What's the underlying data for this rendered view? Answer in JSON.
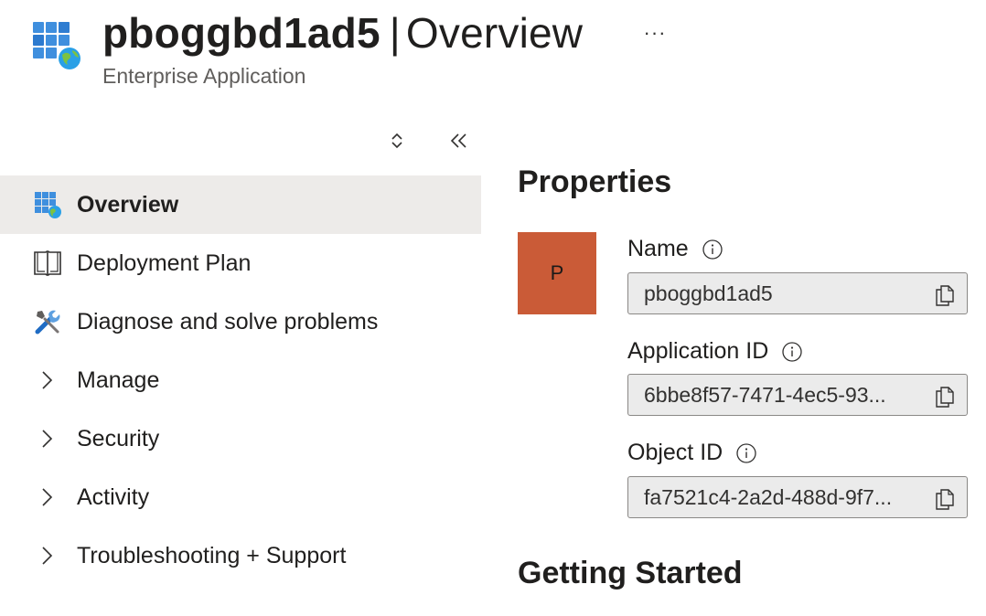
{
  "header": {
    "app_name": "pboggbd1ad5",
    "separator": "|",
    "page_name": "Overview",
    "subtitle": "Enterprise Application",
    "more_label": "···",
    "icon": "enterprise-app-icon"
  },
  "sidebar": {
    "controls": {
      "expand_icon": "up-down-chevron-icon",
      "collapse_icon": "double-chevron-left-icon"
    },
    "items": [
      {
        "label": "Overview",
        "icon": "enterprise-app-icon",
        "selected": true
      },
      {
        "label": "Deployment Plan",
        "icon": "book-icon"
      },
      {
        "label": "Diagnose and solve problems",
        "icon": "wrench-screwdriver-icon"
      },
      {
        "label": "Manage",
        "icon": "chevron-right-icon",
        "expandable": true
      },
      {
        "label": "Security",
        "icon": "chevron-right-icon",
        "expandable": true
      },
      {
        "label": "Activity",
        "icon": "chevron-right-icon",
        "expandable": true
      },
      {
        "label": "Troubleshooting + Support",
        "icon": "chevron-right-icon",
        "expandable": true
      }
    ]
  },
  "main": {
    "properties_heading": "Properties",
    "avatar_letter": "P",
    "avatar_color": "#ca5b37",
    "fields": {
      "name": {
        "label": "Name",
        "value": "pboggbd1ad5"
      },
      "application_id": {
        "label": "Application ID",
        "value": "6bbe8f57-7471-4ec5-93..."
      },
      "object_id": {
        "label": "Object ID",
        "value": "fa7521c4-2a2d-488d-9f7..."
      }
    },
    "getting_started_heading": "Getting Started"
  },
  "colors": {
    "selected_bg": "#edebe9",
    "field_bg": "#ebebeb",
    "icon_blue": "#0078d4"
  }
}
